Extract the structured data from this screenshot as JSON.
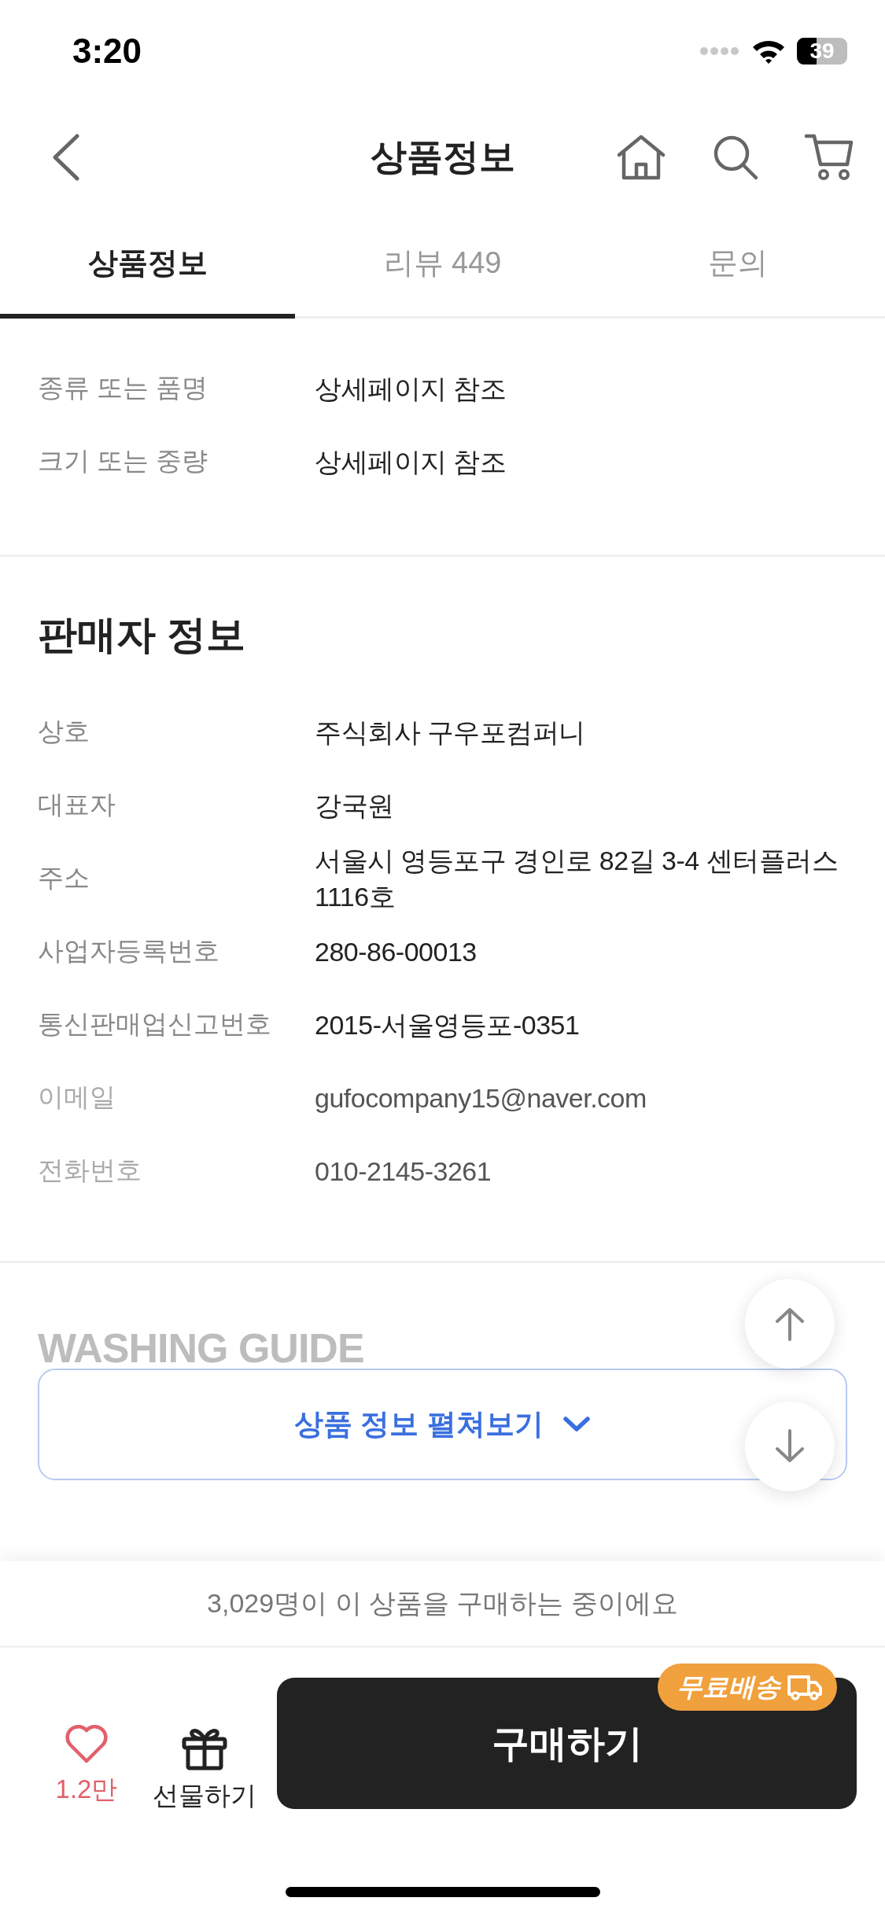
{
  "status_bar": {
    "time": "3:20",
    "battery": "39"
  },
  "header": {
    "title": "상품정보"
  },
  "tabs": [
    {
      "label": "상품정보",
      "selected": true
    },
    {
      "label": "리뷰 449",
      "selected": false
    },
    {
      "label": "문의",
      "selected": false
    }
  ],
  "product_notice": [
    {
      "label": "종류 또는 품명",
      "value": "상세페이지 참조"
    },
    {
      "label": "크기 또는 중량",
      "value": "상세페이지 참조"
    }
  ],
  "seller": {
    "heading": "판매자 정보",
    "rows": [
      {
        "label": "상호",
        "value": "주식회사 구우포컴퍼니",
        "muted": false
      },
      {
        "label": "대표자",
        "value": "강국원",
        "muted": false
      },
      {
        "label": "주소",
        "value": "서울시 영등포구 경인로 82길 3-4 센터플러스 1116호",
        "muted": false
      },
      {
        "label": "사업자등록번호",
        "value": "280-86-00013",
        "muted": false
      },
      {
        "label": "통신판매업신고번호",
        "value": "2015-서울영등포-0351",
        "muted": false
      },
      {
        "label": "이메일",
        "value": "gufocompany15@naver.com",
        "muted": true
      },
      {
        "label": "전화번호",
        "value": "010-2145-3261",
        "muted": true
      }
    ]
  },
  "washing_guide": {
    "heading": "WASHING GUIDE"
  },
  "expand_button": {
    "label": "상품 정보 펼쳐보기"
  },
  "purchase_notice": "3,029명이 이 상품을 구매하는 중이에요",
  "bottom_bar": {
    "like_count": "1.2만",
    "gift_label": "선물하기",
    "buy_label": "구매하기",
    "badge": "무료배송"
  }
}
